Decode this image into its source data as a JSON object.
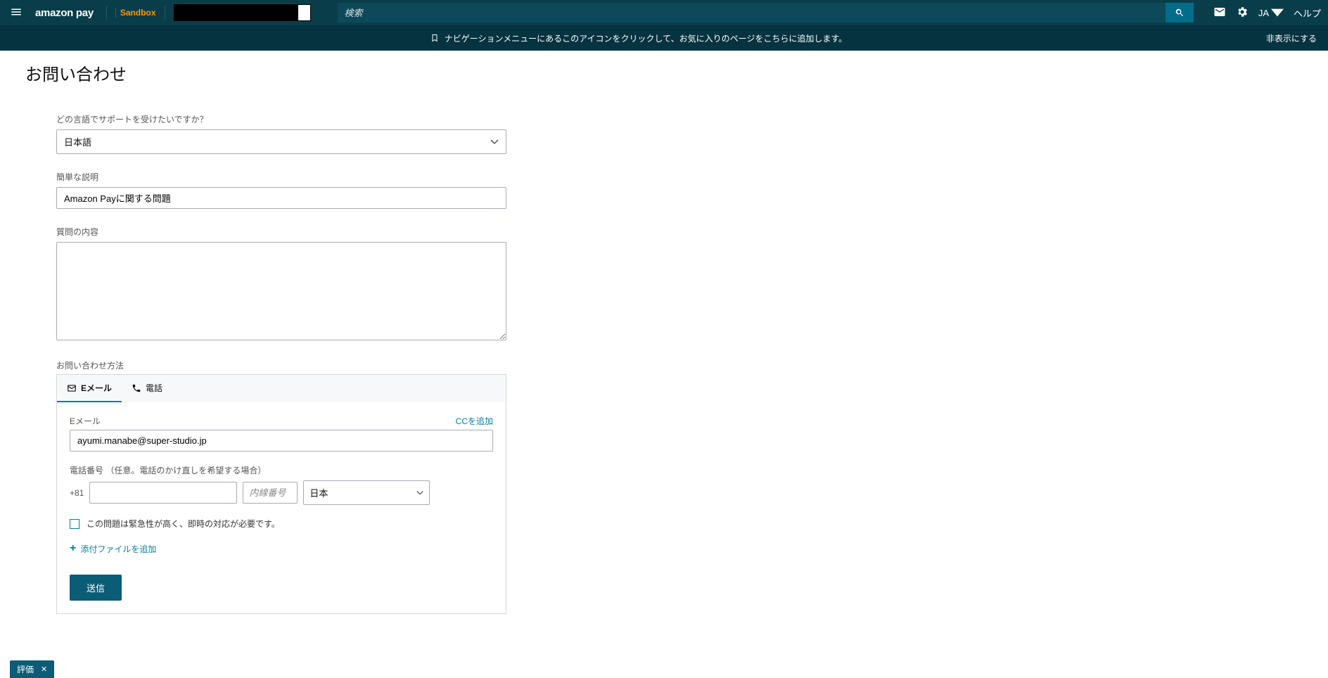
{
  "header": {
    "logo": "amazon pay",
    "sandbox": "Sandbox",
    "search_placeholder": "検索",
    "lang": "JA",
    "help": "ヘルプ"
  },
  "notice": {
    "text": "ナビゲーションメニューにあるこのアイコンをクリックして、お気に入りのページをこちらに追加します。",
    "hide": "非表示にする"
  },
  "page": {
    "title": "お問い合わせ"
  },
  "form": {
    "language_label": "どの言語でサポートを受けたいですか？",
    "language_value": "日本語",
    "desc_label": "簡単な説明",
    "desc_value": "Amazon Payに関する問題",
    "question_label": "質問の内容",
    "question_value": "",
    "contact_method_label": "お問い合わせ方法",
    "tabs": {
      "email": "Eメール",
      "phone": "電話"
    },
    "email_section": {
      "label": "Eメール",
      "cc_link": "CCを追加",
      "value": "ayumi.manabe@super-studio.jp"
    },
    "phone_section": {
      "label": "電話番号 （任意。電話のかけ直しを希望する場合）",
      "prefix": "+81",
      "ext_placeholder": "内線番号",
      "country": "日本"
    },
    "urgent_checkbox": "この問題は緊急性が高く、即時の対応が必要です。",
    "attach_label": "添付ファイルを追加",
    "submit": "送信"
  },
  "feedback": {
    "label": "評価",
    "close": "✕"
  }
}
